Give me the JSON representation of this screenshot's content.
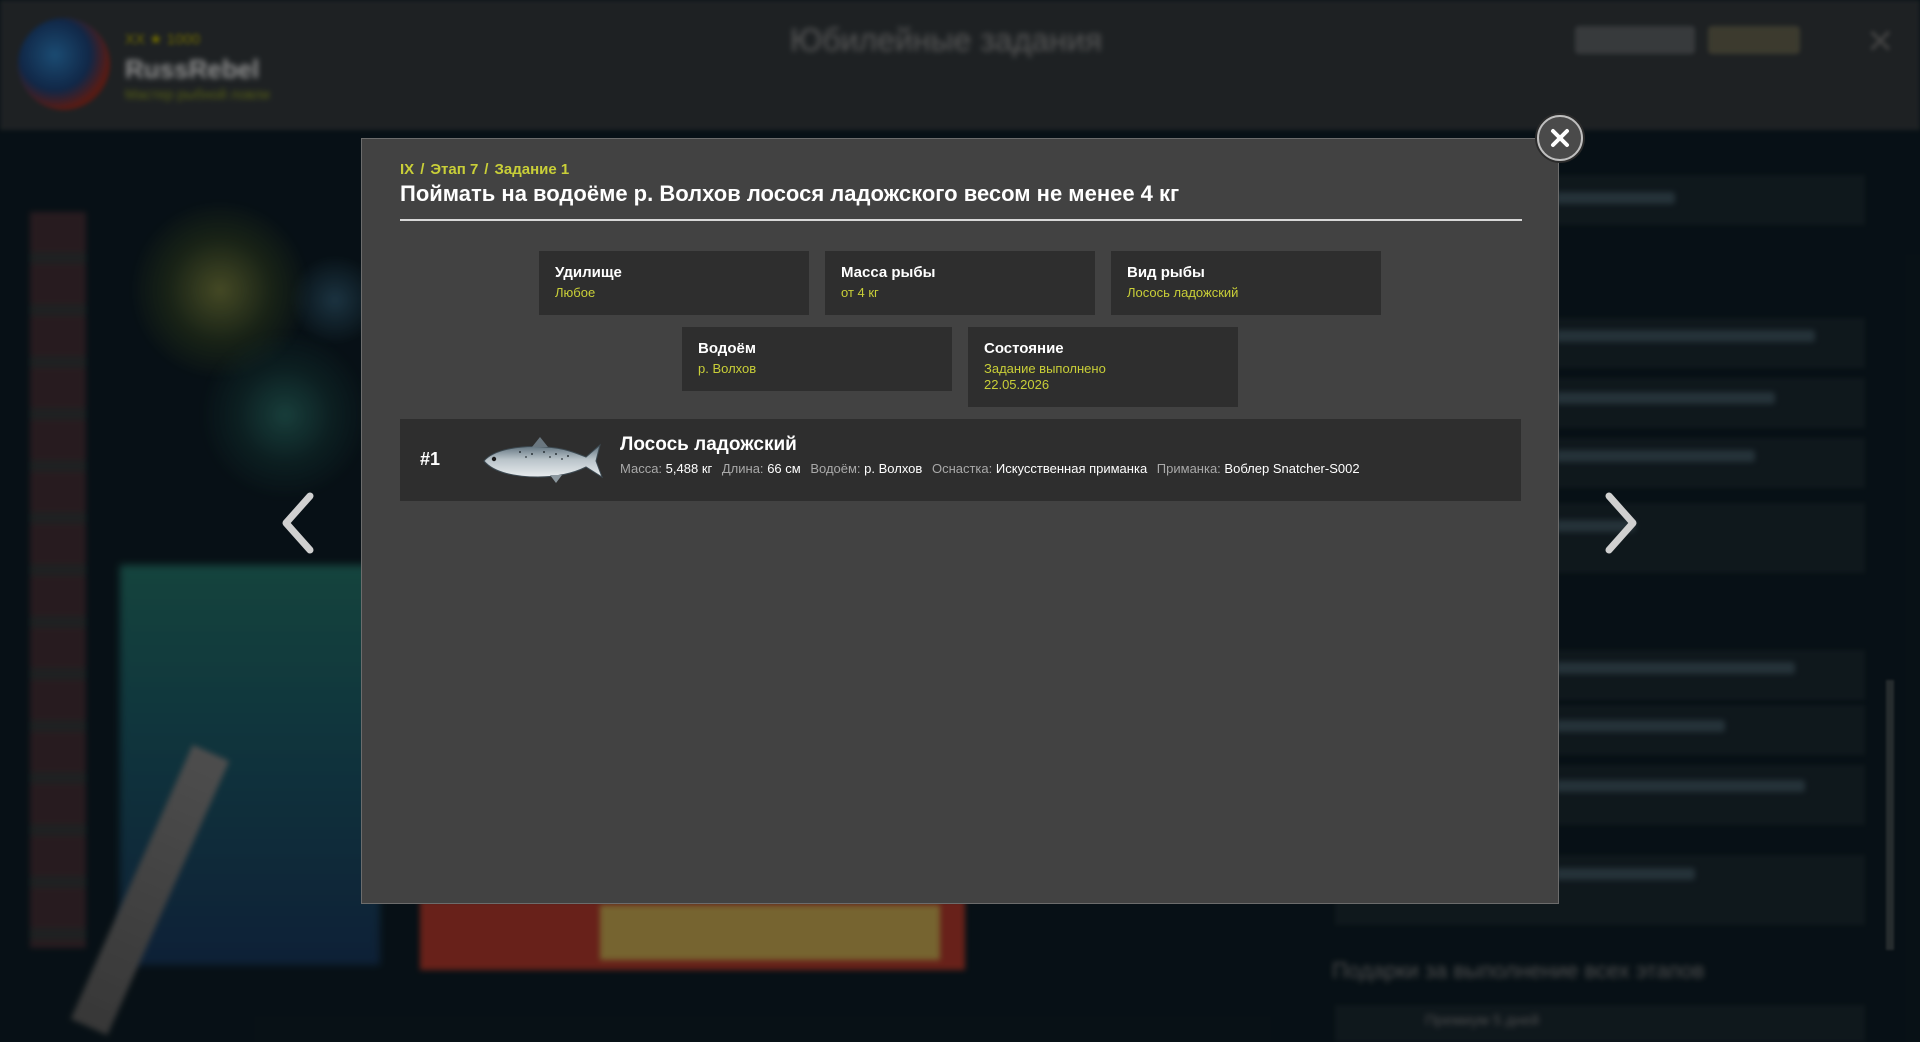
{
  "background": {
    "player_level": "XX ★ 1000",
    "player_nick": "RussRebel",
    "player_subtitle": "Мастер рыбной ловли",
    "screen_title": "Юбилейные задания",
    "bottom_title": "Подарки за выполнение всех этапов",
    "bottom_sub": "Премиум 5 дней"
  },
  "modal": {
    "breadcrumb": [
      "IX",
      "Этап 7",
      "Задание 1"
    ],
    "breadcrumb_sep": "/",
    "title": "Поймать на водоёме р. Волхов лосося ладожского весом не менее 4 кг",
    "conditions": {
      "rod": {
        "label": "Удилище",
        "value": "Любое"
      },
      "mass": {
        "label": "Масса рыбы",
        "value": "от 4 кг"
      },
      "species": {
        "label": "Вид рыбы",
        "value": "Лосось ладожский"
      },
      "water": {
        "label": "Водоём",
        "value": "р. Волхов"
      },
      "state": {
        "label": "Состояние",
        "value": "Задание выполнено",
        "date": "22.05.2026"
      }
    },
    "catch": {
      "number": "#1",
      "fish_icon": "salmon-icon",
      "name": "Лосось ладожский",
      "mass_label": "Масса:",
      "mass_value": "5,488 кг",
      "length_label": "Длина:",
      "length_value": "66 см",
      "water_label": "Водоём:",
      "water_value": "р. Волхов",
      "tackle_label": "Оснастка:",
      "tackle_value": "Искусственная приманка",
      "bait_label": "Приманка:",
      "bait_value": "Воблер Snatcher-S002"
    }
  },
  "colors": {
    "accent": "#c9cf38",
    "modal_bg": "#424242",
    "card_bg": "#2e2e2e"
  },
  "icons": {
    "close": "close-icon",
    "prev": "chevron-left-icon",
    "next": "chevron-right-icon"
  }
}
